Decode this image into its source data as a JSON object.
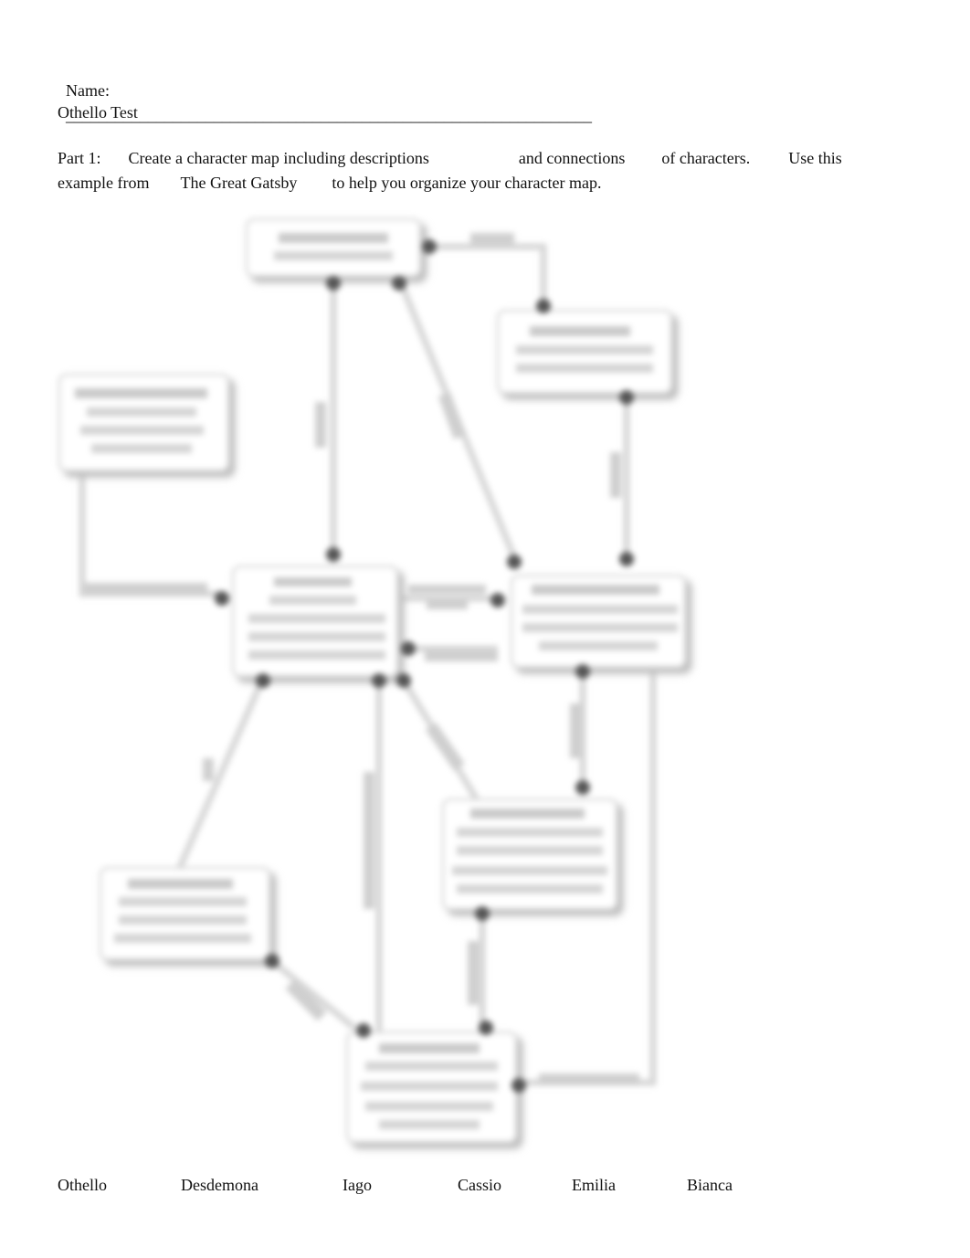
{
  "header": {
    "name_label": "Name:",
    "name_blank": "________________________________________________________________",
    "title": "Othello Test"
  },
  "instructions": {
    "line1": [
      "Part 1:",
      "Create a character map including descriptions",
      "and connections",
      "of characters.",
      "Use this"
    ],
    "line2": [
      "example from",
      "The Great Gatsby",
      "to help you organize your character map."
    ]
  },
  "diagram": {
    "description": "Blurred example character map (The Great Gatsby) — node and connector text is unreadable",
    "node_count": 9,
    "edge_count": 14
  },
  "characters": [
    "Othello",
    "Desdemona",
    "Iago",
    "Cassio",
    "Emilia",
    "Bianca"
  ]
}
